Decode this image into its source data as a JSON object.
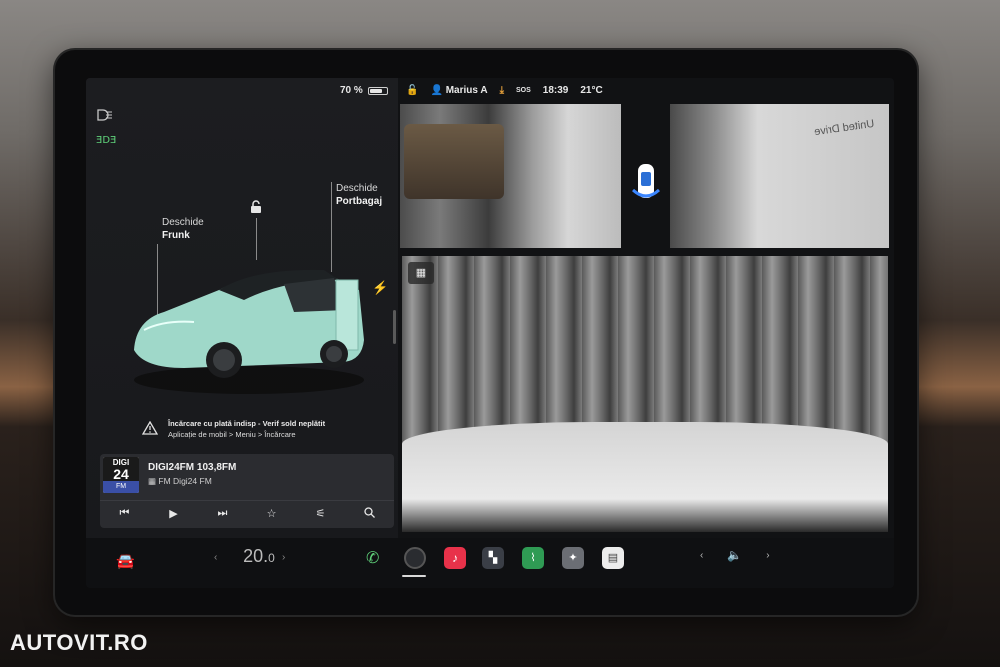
{
  "status": {
    "battery_percent": "70 %",
    "battery_level": 0.7,
    "user": "Marius A",
    "sos": "SOS",
    "time": "18:39",
    "temperature": "21°C"
  },
  "vehicle": {
    "frunk_action": "Deschide",
    "frunk_label": "Frunk",
    "trunk_action": "Deschide",
    "trunk_label": "Portbagaj"
  },
  "notification": {
    "title": "Încărcare cu plată indisp - Verif sold neplătit",
    "subtitle": "Aplicație de mobil > Meniu > Încărcare"
  },
  "media": {
    "logo_top": "DIGI",
    "logo_number": "24",
    "logo_fm": "FM",
    "station": "DIGI24FM 103,8FM",
    "source": "FM Digi24 FM"
  },
  "climate": {
    "temp_display": "20.",
    "temp_decimal": "0"
  },
  "camera": {
    "right_overlay_text": "United Drive"
  },
  "watermark": "AUTOVIT.RO",
  "icons": {
    "headlights": "headlights-icon",
    "edge_lights": "edge-lights-icon",
    "lock": "unlock-icon",
    "bolt": "charging-bolt-icon",
    "warning": "warning-icon",
    "user": "user-icon",
    "download": "download-icon",
    "car": "car-icon",
    "phone": "phone-icon",
    "camera": "camera-icon",
    "music": "music-icon",
    "apps": "apps-icon",
    "energy": "energy-icon",
    "toybox": "toybox-icon",
    "calendar": "calendar-icon",
    "volume": "volume-icon"
  }
}
